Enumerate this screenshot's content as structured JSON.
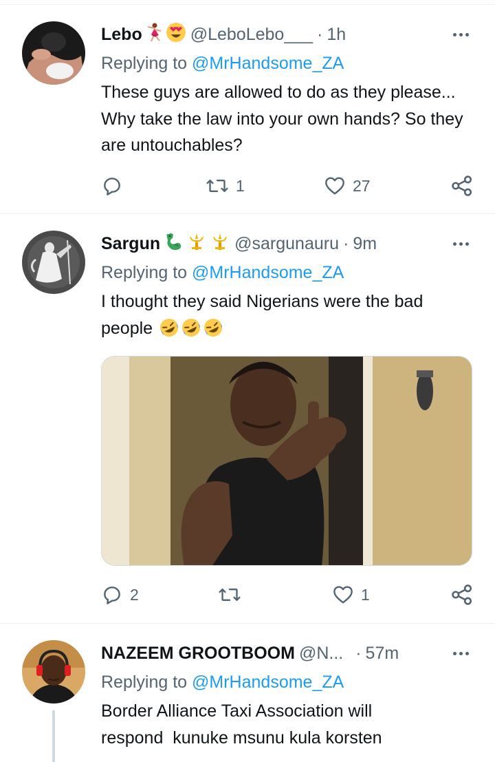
{
  "tweets": [
    {
      "name": "Lebo",
      "handle": "@LeboLebo___",
      "time": "1h",
      "replying_prefix": "Replying to ",
      "replying_to": "@MrHandsome_ZA",
      "text": "These guys are allowed to do as they please... Why take the law into your own hands? So they are untouchables?",
      "retweets": "1",
      "likes": "27",
      "replies": "",
      "emojis": [
        "dancer-emoji",
        "heart-eyes-emoji"
      ]
    },
    {
      "name": "Sargun",
      "handle": "@sargunauru",
      "time": "9m",
      "replying_prefix": "Replying to ",
      "replying_to": "@MrHandsome_ZA",
      "text": "I thought they said Nigerians were the bad people",
      "text_emojis": [
        "rofl-emoji",
        "rofl-emoji",
        "rofl-emoji"
      ],
      "replies": "2",
      "retweets": "",
      "likes": "1",
      "emojis": [
        "dragon-emoji",
        "trident-emoji",
        "trident-emoji"
      ],
      "media": "photo of a person in a black tank top pointing at the camera in a doorway"
    },
    {
      "name": "NAZEEM GROOTBOOM",
      "handle": "@N...",
      "time": "57m",
      "replying_prefix": "Replying to ",
      "replying_to": "@MrHandsome_ZA",
      "text": "Border Alliance Taxi Association will respond  kunuke msunu kula korsten"
    }
  ],
  "colors": {
    "text": "#0f1419",
    "secondary": "#536471",
    "link": "#1d9bf0",
    "divider": "#eff3f4"
  }
}
